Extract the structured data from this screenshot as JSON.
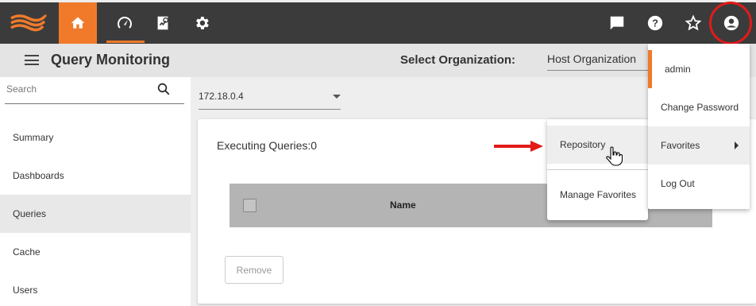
{
  "colors": {
    "accent": "#f07a2a",
    "topbar": "#3b3b3b",
    "highlight": "#e21a1a"
  },
  "topbar": {
    "logo": "brand-logo",
    "nav_icons": [
      "home-icon",
      "speedometer-icon",
      "report-icon",
      "gear-icon"
    ],
    "right_icons": [
      "chat-icon",
      "help-icon",
      "star-icon",
      "user-circle-icon"
    ]
  },
  "header": {
    "title": "Query Monitoring",
    "org_label": "Select Organization:",
    "org_value": "Host Organization"
  },
  "sidebar": {
    "search_placeholder": "Search",
    "items": [
      {
        "label": "Summary"
      },
      {
        "label": "Dashboards"
      },
      {
        "label": "Queries",
        "active": true
      },
      {
        "label": "Cache"
      },
      {
        "label": "Users"
      }
    ]
  },
  "main": {
    "server_select": "172.18.0.4",
    "executing_label": "Executing Queries:0",
    "table": {
      "columns": [
        "Name"
      ]
    },
    "remove_label": "Remove"
  },
  "favorites_menu": {
    "items": [
      "Repository",
      "Manage Favorites"
    ]
  },
  "user_menu": {
    "username": "admin",
    "items": [
      "Change Password",
      "Favorites",
      "Log Out"
    ]
  }
}
